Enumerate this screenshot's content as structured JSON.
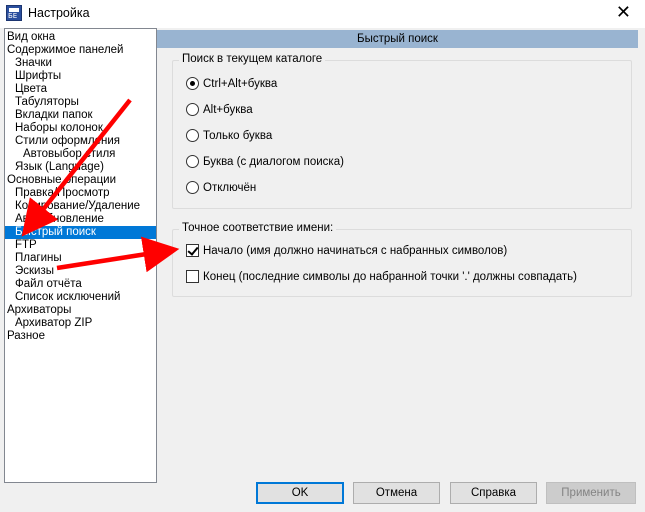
{
  "window": {
    "title": "Настройка",
    "close_glyph": "✕"
  },
  "tree": {
    "items": [
      {
        "label": "Вид окна",
        "indent": 0
      },
      {
        "label": "Содержимое панелей",
        "indent": 0
      },
      {
        "label": "Значки",
        "indent": 1
      },
      {
        "label": "Шрифты",
        "indent": 1
      },
      {
        "label": "Цвета",
        "indent": 1
      },
      {
        "label": "Табуляторы",
        "indent": 1
      },
      {
        "label": "Вкладки папок",
        "indent": 1
      },
      {
        "label": "Наборы колонок",
        "indent": 1
      },
      {
        "label": "Стили оформления",
        "indent": 1
      },
      {
        "label": "Автовыбор стиля",
        "indent": 2
      },
      {
        "label": "Язык (Language)",
        "indent": 1
      },
      {
        "label": "Основные операции",
        "indent": 0
      },
      {
        "label": "Правка/Просмотр",
        "indent": 1
      },
      {
        "label": "Копирование/Удаление",
        "indent": 1
      },
      {
        "label": "Автообновление",
        "indent": 1
      },
      {
        "label": "Быстрый поиск",
        "indent": 1,
        "selected": true
      },
      {
        "label": "FTP",
        "indent": 1
      },
      {
        "label": "Плагины",
        "indent": 1
      },
      {
        "label": "Эскизы",
        "indent": 1
      },
      {
        "label": "Файл отчёта",
        "indent": 1
      },
      {
        "label": "Список исключений",
        "indent": 1
      },
      {
        "label": "Архиваторы",
        "indent": 0
      },
      {
        "label": "Архиватор ZIP",
        "indent": 1
      },
      {
        "label": "Разное",
        "indent": 0
      }
    ]
  },
  "panel": {
    "header": "Быстрый поиск",
    "search_group": {
      "title": "Поиск в текущем каталоге",
      "options": [
        {
          "label": "Ctrl+Alt+буква",
          "checked": true
        },
        {
          "label": "Alt+буква",
          "checked": false
        },
        {
          "label": "Только буква",
          "checked": false
        },
        {
          "label": "Буква (с диалогом поиска)",
          "checked": false
        },
        {
          "label": "Отключён",
          "checked": false
        }
      ]
    },
    "match_group": {
      "title": "Точное соответствие имени:",
      "options": [
        {
          "label": "Начало (имя должно начинаться с набранных символов)",
          "checked": true
        },
        {
          "label": "Конец (последние символы до набранной точки '.' должны совпадать)",
          "checked": false
        }
      ]
    }
  },
  "buttons": {
    "ok": "OK",
    "cancel": "Отмена",
    "help": "Справка",
    "apply": "Применить"
  },
  "annotation_color": "#ff0000"
}
